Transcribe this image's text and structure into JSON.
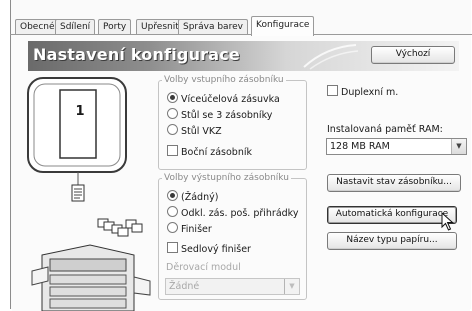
{
  "tabs": [
    "Obecné",
    "Sdílení",
    "Porty",
    "Upřesnit",
    "Správa barev",
    "Konfigurace"
  ],
  "active_tab": "Konfigurace",
  "header": {
    "title": "Nastavení konfigurace",
    "default_button": "Výchozí"
  },
  "preview": {
    "tray_number": "1"
  },
  "input_tray_group": {
    "legend": "Volby vstupního zásobníku",
    "options": [
      "Víceúčelová zásuvka",
      "Stůl se 3 zásobníky",
      "Stůl VKZ"
    ],
    "selected": "Víceúčelová zásuvka",
    "side_tray_label": "Boční zásobník",
    "side_tray_checked": false
  },
  "output_tray_group": {
    "legend": "Volby výstupního zásobníku",
    "options": [
      "(Žádný)",
      "Odkl. zás. poš. přihrádky",
      "Finišer"
    ],
    "selected": "(Žádný)",
    "saddle_finisher_label": "Sedlový finišer",
    "saddle_finisher_checked": false,
    "punch_module_label": "Děrovací modul",
    "punch_module_value": "Žádné"
  },
  "duplex": {
    "label": "Duplexní m.",
    "checked": false
  },
  "memory": {
    "label": "Instalovaná paměť RAM:",
    "value": "128 MB RAM"
  },
  "buttons": {
    "set_tray_status": "Nastavit stav zásobníku...",
    "auto_config": "Automatická konfigurace",
    "paper_type_name": "Název typu papíru..."
  },
  "colors": {
    "banner_dark": "#6a6a6a",
    "banner_light": "#f3f3f3"
  },
  "icons": [
    "document-icon",
    "printer-icon",
    "mouse-cursor-icon"
  ]
}
